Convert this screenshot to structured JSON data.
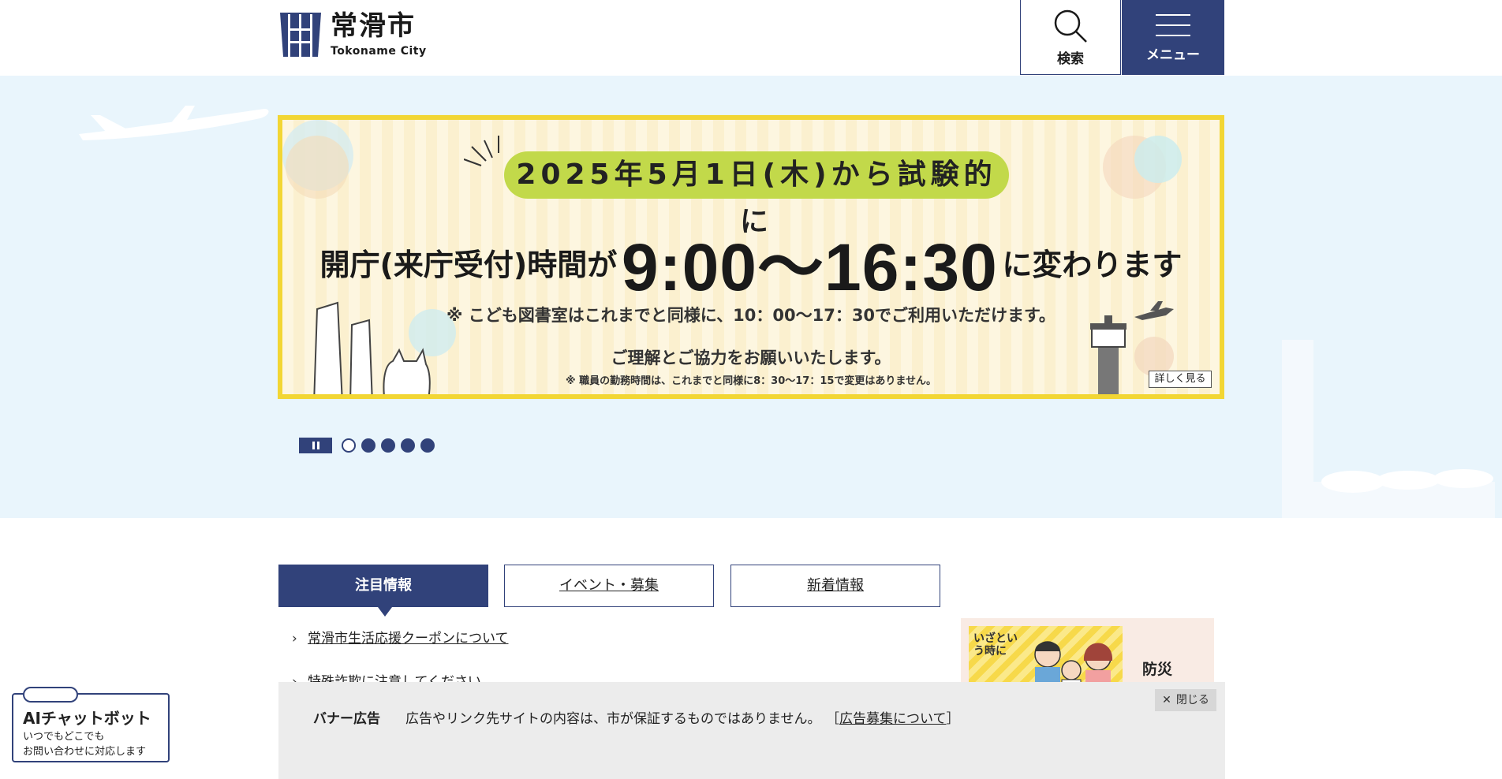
{
  "header": {
    "logo_jp": "常滑市",
    "logo_en": "Tokoname City",
    "search_label": "検索",
    "menu_label": "メニュー",
    "brand_color": "#31427a"
  },
  "hero_banner": {
    "date_line_parts": [
      "2025年5月1日(木)から試験的に"
    ],
    "main_pre": "開庁(来庁受付)時間が",
    "main_time": "9:00〜16:30",
    "main_post": "に変わります",
    "note1": "※ こども図書室はこれまでと同様に、10：00〜17：30でご利用いただけます。",
    "note2": "ご理解とご協力をお願いいたします。",
    "note3": "※ 職員の勤務時間は、これまでと同様に8：30〜17：15で変更はありません。",
    "detail_button": "詳しく見る",
    "border_color": "#f2d634",
    "pill_color": "#c2d94a"
  },
  "slider": {
    "pause_icon": "pause-icon",
    "slide_count": 5,
    "active_slide": 1
  },
  "tabs": {
    "items": [
      {
        "label": "注目情報",
        "active": true
      },
      {
        "label": "イベント・募集",
        "active": false
      },
      {
        "label": "新着情報",
        "active": false
      }
    ]
  },
  "news": {
    "items": [
      "常滑市生活応援クーポンについて",
      "特殊詐欺に注意してください"
    ]
  },
  "side_card": {
    "title": "防災",
    "image_text": "いざという時に"
  },
  "adbar": {
    "label": "バナー広告",
    "text": "広告やリンク先サイトの内容は、市が保証するものではありません。",
    "link_open": "［",
    "link": "広告募集について",
    "link_close": "］",
    "close_label": "閉じる"
  },
  "chatbot": {
    "title": "AIチャットボット",
    "sub1": "いつでもどこでも",
    "sub2": "お問い合わせに対応します"
  }
}
